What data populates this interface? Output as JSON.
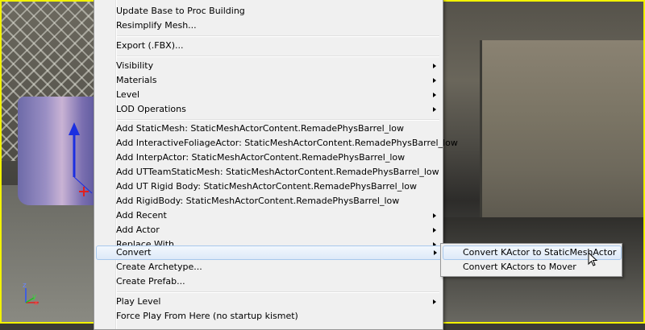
{
  "colors": {
    "frame_border": "#f2f200",
    "menu_bg": "#f0f0f0",
    "hover_bg": "#dde9f8",
    "hover_border": "#a8c8ec"
  },
  "viewport": {
    "gizmo_labels": {
      "x": "x",
      "y": "y",
      "z": "z"
    }
  },
  "context_menu": {
    "items": [
      {
        "label": "Update Base to Proc Building",
        "submenu": false
      },
      {
        "label": "Resimplify Mesh...",
        "submenu": false
      },
      {
        "label": "Export (.FBX)...",
        "submenu": false
      },
      {
        "label": "Visibility",
        "submenu": true
      },
      {
        "label": "Materials",
        "submenu": true
      },
      {
        "label": "Level",
        "submenu": true
      },
      {
        "label": "LOD Operations",
        "submenu": true
      },
      {
        "label": "Add StaticMesh: StaticMeshActorContent.RemadePhysBarrel_low",
        "submenu": false
      },
      {
        "label": "Add InteractiveFoliageActor: StaticMeshActorContent.RemadePhysBarrel_low",
        "submenu": false
      },
      {
        "label": "Add InterpActor: StaticMeshActorContent.RemadePhysBarrel_low",
        "submenu": false
      },
      {
        "label": "Add UTTeamStaticMesh: StaticMeshActorContent.RemadePhysBarrel_low",
        "submenu": false
      },
      {
        "label": "Add UT Rigid Body: StaticMeshActorContent.RemadePhysBarrel_low",
        "submenu": false
      },
      {
        "label": "Add RigidBody: StaticMeshActorContent.RemadePhysBarrel_low",
        "submenu": false
      },
      {
        "label": "Add Recent",
        "submenu": true
      },
      {
        "label": "Add Actor",
        "submenu": true
      },
      {
        "label": "Replace With",
        "submenu": true
      },
      {
        "label": "Convert",
        "submenu": true,
        "active": true
      },
      {
        "label": "Create Archetype...",
        "submenu": false
      },
      {
        "label": "Create Prefab...",
        "submenu": false
      },
      {
        "label": "Play Level",
        "submenu": true
      },
      {
        "label": "Force Play From Here (no startup kismet)",
        "submenu": false
      }
    ]
  },
  "convert_submenu": {
    "items": [
      {
        "label": "Convert KActor to StaticMeshActor",
        "active": true
      },
      {
        "label": "Convert KActors to Mover"
      }
    ]
  }
}
